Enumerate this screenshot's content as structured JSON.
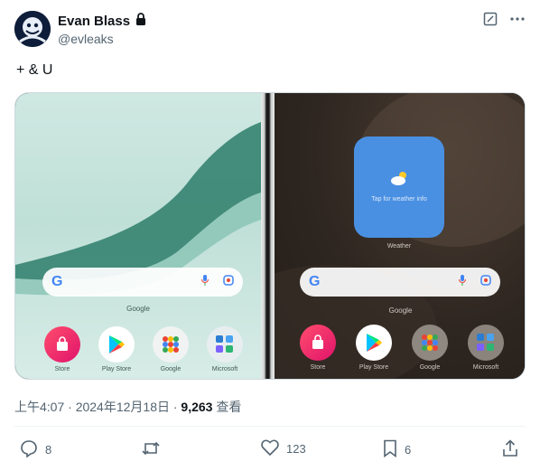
{
  "author": {
    "name": "Evan Blass",
    "handle": "@evleaks",
    "verified_icon": "lock-icon"
  },
  "top_actions": [
    "edit-icon",
    "more-icon"
  ],
  "tweet": {
    "text": "+ & U"
  },
  "media": {
    "left_screen": {
      "search_caption": "Google",
      "apps": [
        {
          "label": "Store",
          "icon": "store-bag-icon"
        },
        {
          "label": "Play Store",
          "icon": "play-store-icon"
        },
        {
          "label": "Google",
          "icon": "google-folder-icon"
        },
        {
          "label": "Microsoft",
          "icon": "microsoft-folder-icon"
        }
      ]
    },
    "right_screen": {
      "weather_sub": "Tap for weather info",
      "weather_caption": "Weather",
      "search_caption": "Google",
      "apps": [
        {
          "label": "Store",
          "icon": "store-bag-icon"
        },
        {
          "label": "Play Store",
          "icon": "play-store-icon"
        },
        {
          "label": "Google",
          "icon": "google-folder-icon"
        },
        {
          "label": "Microsoft",
          "icon": "microsoft-folder-icon"
        }
      ]
    }
  },
  "meta": {
    "time": "上午4:07 · 2024年12月18日 · ",
    "views_count": "9,263",
    "views_label": " 查看"
  },
  "actions": {
    "replies": "8",
    "reposts": "",
    "likes": "123",
    "bookmarks": "6"
  }
}
